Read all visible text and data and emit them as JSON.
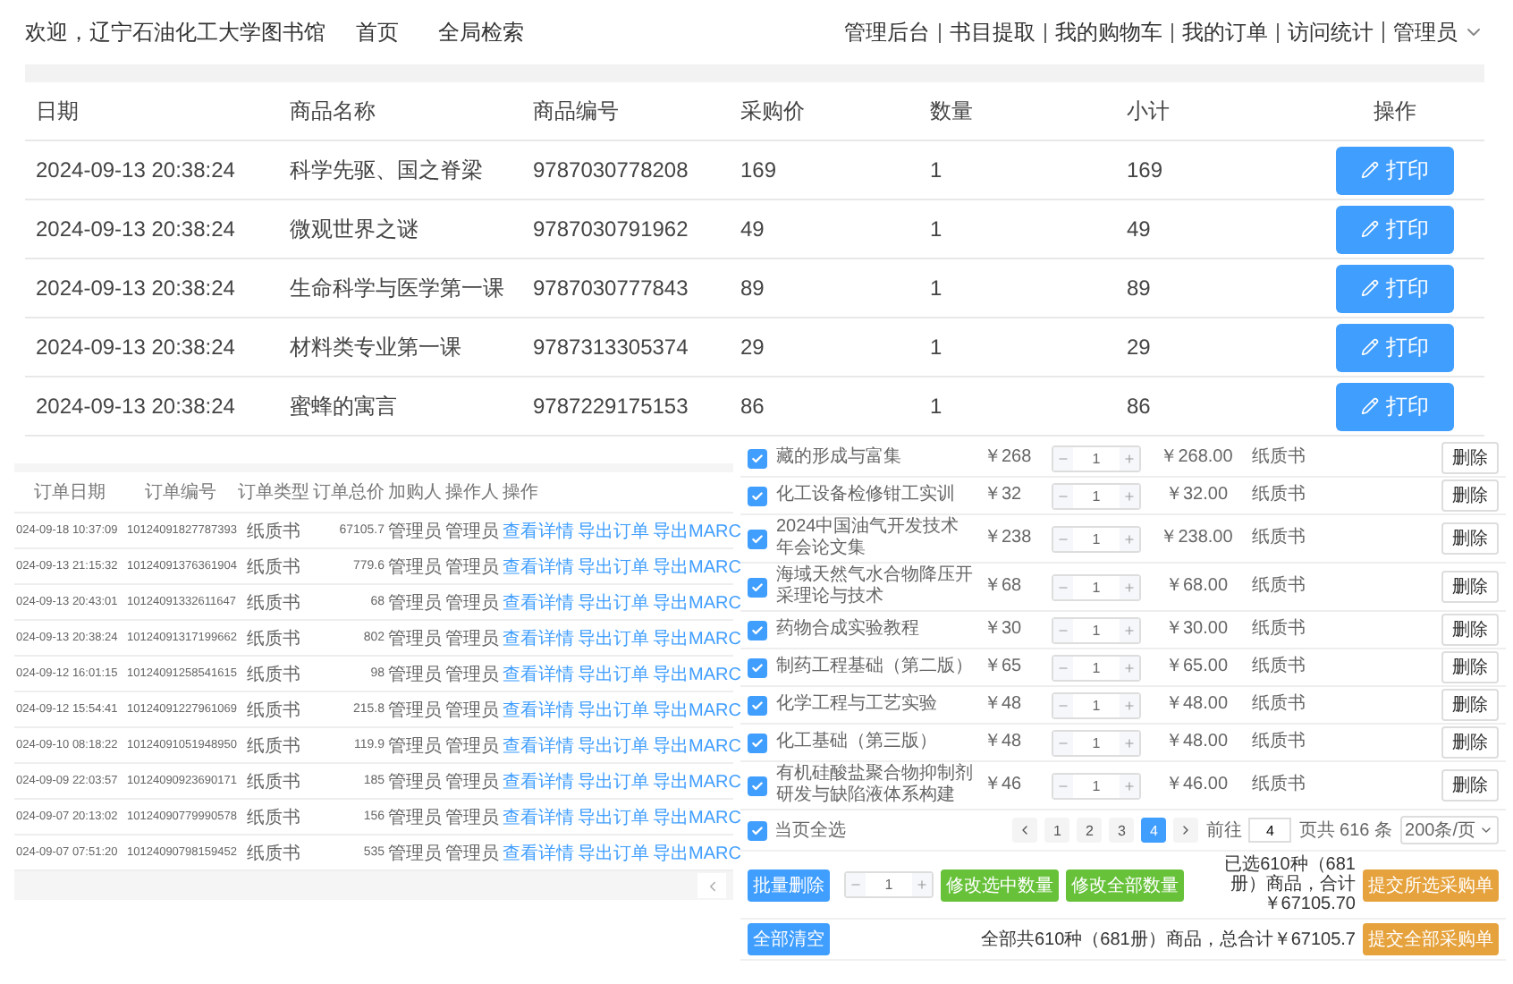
{
  "header": {
    "welcome": "欢迎，辽宁石油化工大学图书馆",
    "nav_left": [
      "首页",
      "全局检索"
    ],
    "nav_right": [
      "管理后台",
      "书目提取",
      "我的购物车",
      "我的订单",
      "访问统计"
    ],
    "user": "管理员"
  },
  "purchase_table": {
    "columns": [
      "日期",
      "商品名称",
      "商品编号",
      "采购价",
      "数量",
      "小计",
      "操作"
    ],
    "rows": [
      {
        "date": "2024-09-13 20:38:24",
        "name": "科学先驱、国之脊梁",
        "isbn": "9787030778208",
        "price": "169",
        "qty": "1",
        "subtotal": "169",
        "action": "打印"
      },
      {
        "date": "2024-09-13 20:38:24",
        "name": "微观世界之谜",
        "isbn": "9787030791962",
        "price": "49",
        "qty": "1",
        "subtotal": "49",
        "action": "打印"
      },
      {
        "date": "2024-09-13 20:38:24",
        "name": "生命科学与医学第一课",
        "isbn": "9787030777843",
        "price": "89",
        "qty": "1",
        "subtotal": "89",
        "action": "打印"
      },
      {
        "date": "2024-09-13 20:38:24",
        "name": "材料类专业第一课",
        "isbn": "9787313305374",
        "price": "29",
        "qty": "1",
        "subtotal": "29",
        "action": "打印"
      },
      {
        "date": "2024-09-13 20:38:24",
        "name": "蜜蜂的寓言",
        "isbn": "9787229175153",
        "price": "86",
        "qty": "1",
        "subtotal": "86",
        "action": "打印"
      }
    ]
  },
  "orders_table": {
    "columns": [
      "订单日期",
      "订单编号",
      "订单类型",
      "订单总价",
      "加购人",
      "操作人",
      "操作"
    ],
    "rows": [
      {
        "date": "024-09-18 10:37:09",
        "order_no": "10124091827787393",
        "type": "纸质书",
        "total": "67105.7",
        "buyer": "管理员",
        "operator": "管理员",
        "actions": [
          "查看详情",
          "导出订单",
          "导出MARC"
        ]
      },
      {
        "date": "024-09-13 21:15:32",
        "order_no": "10124091376361904",
        "type": "纸质书",
        "total": "779.6",
        "buyer": "管理员",
        "operator": "管理员",
        "actions": [
          "查看详情",
          "导出订单",
          "导出MARC"
        ]
      },
      {
        "date": "024-09-13 20:43:01",
        "order_no": "10124091332611647",
        "type": "纸质书",
        "total": "68",
        "buyer": "管理员",
        "operator": "管理员",
        "actions": [
          "查看详情",
          "导出订单",
          "导出MARC"
        ]
      },
      {
        "date": "024-09-13 20:38:24",
        "order_no": "10124091317199662",
        "type": "纸质书",
        "total": "802",
        "buyer": "管理员",
        "operator": "管理员",
        "actions": [
          "查看详情",
          "导出订单",
          "导出MARC"
        ]
      },
      {
        "date": "024-09-12 16:01:15",
        "order_no": "10124091258541615",
        "type": "纸质书",
        "total": "98",
        "buyer": "管理员",
        "operator": "管理员",
        "actions": [
          "查看详情",
          "导出订单",
          "导出MARC"
        ]
      },
      {
        "date": "024-09-12 15:54:41",
        "order_no": "10124091227961069",
        "type": "纸质书",
        "total": "215.8",
        "buyer": "管理员",
        "operator": "管理员",
        "actions": [
          "查看详情",
          "导出订单",
          "导出MARC"
        ]
      },
      {
        "date": "024-09-10 08:18:22",
        "order_no": "10124091051948950",
        "type": "纸质书",
        "total": "119.9",
        "buyer": "管理员",
        "operator": "管理员",
        "actions": [
          "查看详情",
          "导出订单",
          "导出MARC"
        ]
      },
      {
        "date": "024-09-09 22:03:57",
        "order_no": "10124090923690171",
        "type": "纸质书",
        "total": "185",
        "buyer": "管理员",
        "operator": "管理员",
        "actions": [
          "查看详情",
          "导出订单",
          "导出MARC"
        ]
      },
      {
        "date": "024-09-07 20:13:02",
        "order_no": "10124090779990578",
        "type": "纸质书",
        "total": "156",
        "buyer": "管理员",
        "operator": "管理员",
        "actions": [
          "查看详情",
          "导出订单",
          "导出MARC"
        ]
      },
      {
        "date": "024-09-07 07:51:20",
        "order_no": "10124090798159452",
        "type": "纸质书",
        "total": "535",
        "buyer": "管理员",
        "operator": "管理员",
        "actions": [
          "查看详情",
          "导出订单",
          "导出MARC"
        ]
      }
    ]
  },
  "cart": {
    "items": [
      {
        "title": "藏的形成与富集",
        "price": "￥268",
        "qty": "1",
        "subtotal": "￥268.00",
        "type": "纸质书",
        "checked": true,
        "action": "删除"
      },
      {
        "title": "化工设备检修钳工实训",
        "price": "￥32",
        "qty": "1",
        "subtotal": "￥32.00",
        "type": "纸质书",
        "checked": true,
        "action": "删除"
      },
      {
        "title": "2024中国油气开发技术年会论文集",
        "price": "￥238",
        "qty": "1",
        "subtotal": "￥238.00",
        "type": "纸质书",
        "checked": true,
        "action": "删除"
      },
      {
        "title": "海域天然气水合物降压开采理论与技术",
        "price": "￥68",
        "qty": "1",
        "subtotal": "￥68.00",
        "type": "纸质书",
        "checked": true,
        "action": "删除"
      },
      {
        "title": "药物合成实验教程",
        "price": "￥30",
        "qty": "1",
        "subtotal": "￥30.00",
        "type": "纸质书",
        "checked": true,
        "action": "删除"
      },
      {
        "title": "制药工程基础（第二版）",
        "price": "￥65",
        "qty": "1",
        "subtotal": "￥65.00",
        "type": "纸质书",
        "checked": true,
        "action": "删除"
      },
      {
        "title": "化学工程与工艺实验",
        "price": "￥48",
        "qty": "1",
        "subtotal": "￥48.00",
        "type": "纸质书",
        "checked": true,
        "action": "删除"
      },
      {
        "title": "化工基础（第三版）",
        "price": "￥48",
        "qty": "1",
        "subtotal": "￥48.00",
        "type": "纸质书",
        "checked": true,
        "action": "删除"
      },
      {
        "title": "有机硅酸盐聚合物抑制剂研发与缺陷液体系构建",
        "price": "￥46",
        "qty": "1",
        "subtotal": "￥46.00",
        "type": "纸质书",
        "checked": true,
        "action": "删除"
      }
    ],
    "select_page": {
      "label": "当页全选",
      "checked": true
    },
    "pagination": {
      "pages": [
        {
          "label": "1",
          "selected": false
        },
        {
          "label": "2",
          "selected": false
        },
        {
          "label": "3",
          "selected": false
        },
        {
          "label": "4",
          "selected": true
        }
      ],
      "goto_label": "前往",
      "goto_value": "4",
      "total": "页共 616 条",
      "page_size": "200条/页"
    },
    "batch": {
      "delete_button": "批量删除",
      "qty": "1",
      "buttons": [
        "修改选中数量",
        "修改全部数量"
      ],
      "summary": "已选610种（681册）商品，合计￥67105.70",
      "submit": "提交所选采购单"
    },
    "all": {
      "clear_button": "全部清空",
      "summary": "全部共610种（681册）商品，总合计￥67105.7",
      "submit": "提交全部采购单"
    }
  }
}
